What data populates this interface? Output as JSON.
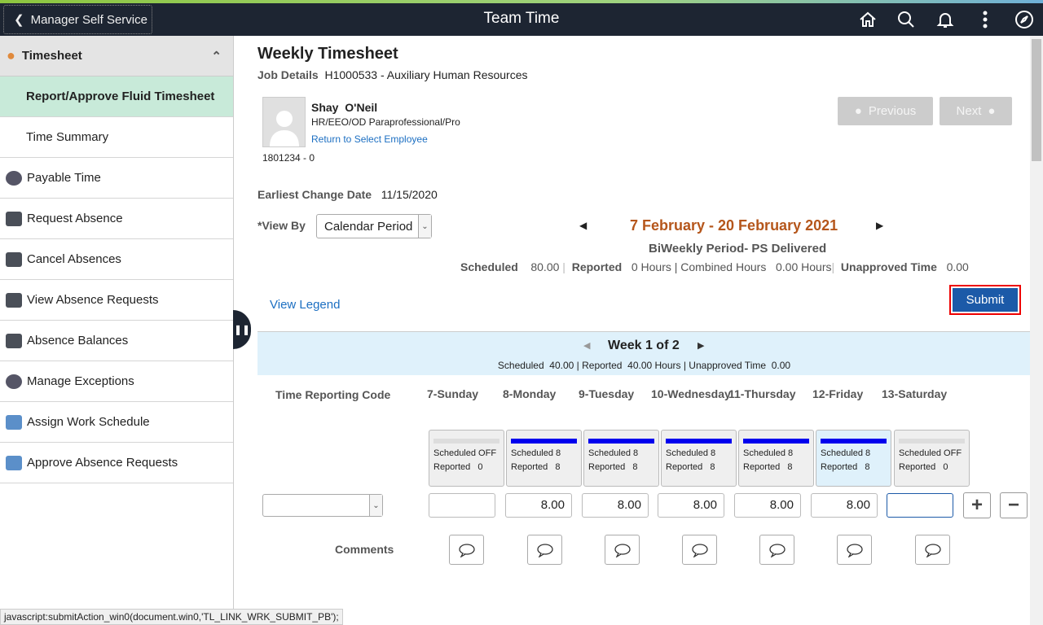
{
  "header": {
    "back_label": "Manager Self Service",
    "title": "Team Time"
  },
  "sidebar": {
    "section": "Timesheet",
    "items": [
      {
        "label": "Report/Approve Fluid Timesheet",
        "icon": "none",
        "sub": true,
        "selected": true
      },
      {
        "label": "Time Summary",
        "icon": "none",
        "sub": true
      },
      {
        "label": "Payable Time",
        "icon": "clock-money-icon"
      },
      {
        "label": "Request Absence",
        "icon": "briefcase-icon"
      },
      {
        "label": "Cancel Absences",
        "icon": "briefcase-cancel-icon"
      },
      {
        "label": "View Absence Requests",
        "icon": "briefcase-calendar-icon"
      },
      {
        "label": "Absence Balances",
        "icon": "briefcase-balance-icon"
      },
      {
        "label": "Manage Exceptions",
        "icon": "clock-exception-icon"
      },
      {
        "label": "Assign Work Schedule",
        "icon": "calendar-icon"
      },
      {
        "label": "Approve Absence Requests",
        "icon": "calendar-icon"
      }
    ]
  },
  "page": {
    "title": "Weekly Timesheet",
    "job_label": "Job Details",
    "job_value": "H1000533 - Auxiliary Human Resources",
    "employee": {
      "first": "Shay",
      "last": "O'Neil",
      "title": "HR/EEO/OD Paraprofessional/Pro",
      "return_link": "Return to Select Employee",
      "id": "1801234 - 0"
    },
    "previous": "Previous",
    "next": "Next",
    "earliest_label": "Earliest Change Date",
    "earliest_value": "11/15/2020",
    "view_by_label": "*View By",
    "view_by_value": "Calendar Period",
    "period": "7 February - 20 February 2021",
    "period_type": "BiWeekly Period- PS Delivered",
    "summary": {
      "scheduled_label": "Scheduled",
      "scheduled": "80.00",
      "reported_label": "Reported",
      "reported": "0 Hours | Combined Hours",
      "combined": "0.00 Hours",
      "unapproved_label": "Unapproved Time",
      "unapproved": "0.00"
    },
    "view_legend": "View Legend",
    "submit": "Submit",
    "week": {
      "title": "Week 1 of 2",
      "summary": "Scheduled  40.00 | Reported  40.00 Hours | Unapproved Time  0.00"
    },
    "trc_label": "Time Reporting Code",
    "comments_label": "Comments",
    "days": [
      {
        "name": "7-Sunday",
        "scheduled": "Scheduled OFF",
        "reported": "Reported   0",
        "value": "",
        "on": false
      },
      {
        "name": "8-Monday",
        "scheduled": "Scheduled 8",
        "reported": "Reported   8",
        "value": "8.00",
        "on": true
      },
      {
        "name": "9-Tuesday",
        "scheduled": "Scheduled 8",
        "reported": "Reported   8",
        "value": "8.00",
        "on": true
      },
      {
        "name": "10-Wednesday",
        "scheduled": "Scheduled 8",
        "reported": "Reported   8",
        "value": "8.00",
        "on": true
      },
      {
        "name": "11-Thursday",
        "scheduled": "Scheduled 8",
        "reported": "Reported   8",
        "value": "8.00",
        "on": true
      },
      {
        "name": "12-Friday",
        "scheduled": "Scheduled 8",
        "reported": "Reported   8",
        "value": "8.00",
        "on": true,
        "today": true
      },
      {
        "name": "13-Saturday",
        "scheduled": "Scheduled OFF",
        "reported": "Reported   0",
        "value": "",
        "on": false
      }
    ]
  },
  "statusbar": "javascript:submitAction_win0(document.win0,'TL_LINK_WRK_SUBMIT_PB');",
  "colors": {
    "accent": "#1c5aa8",
    "period": "#b5561b",
    "header": "#1d2532",
    "selected": "#c8ead9"
  }
}
